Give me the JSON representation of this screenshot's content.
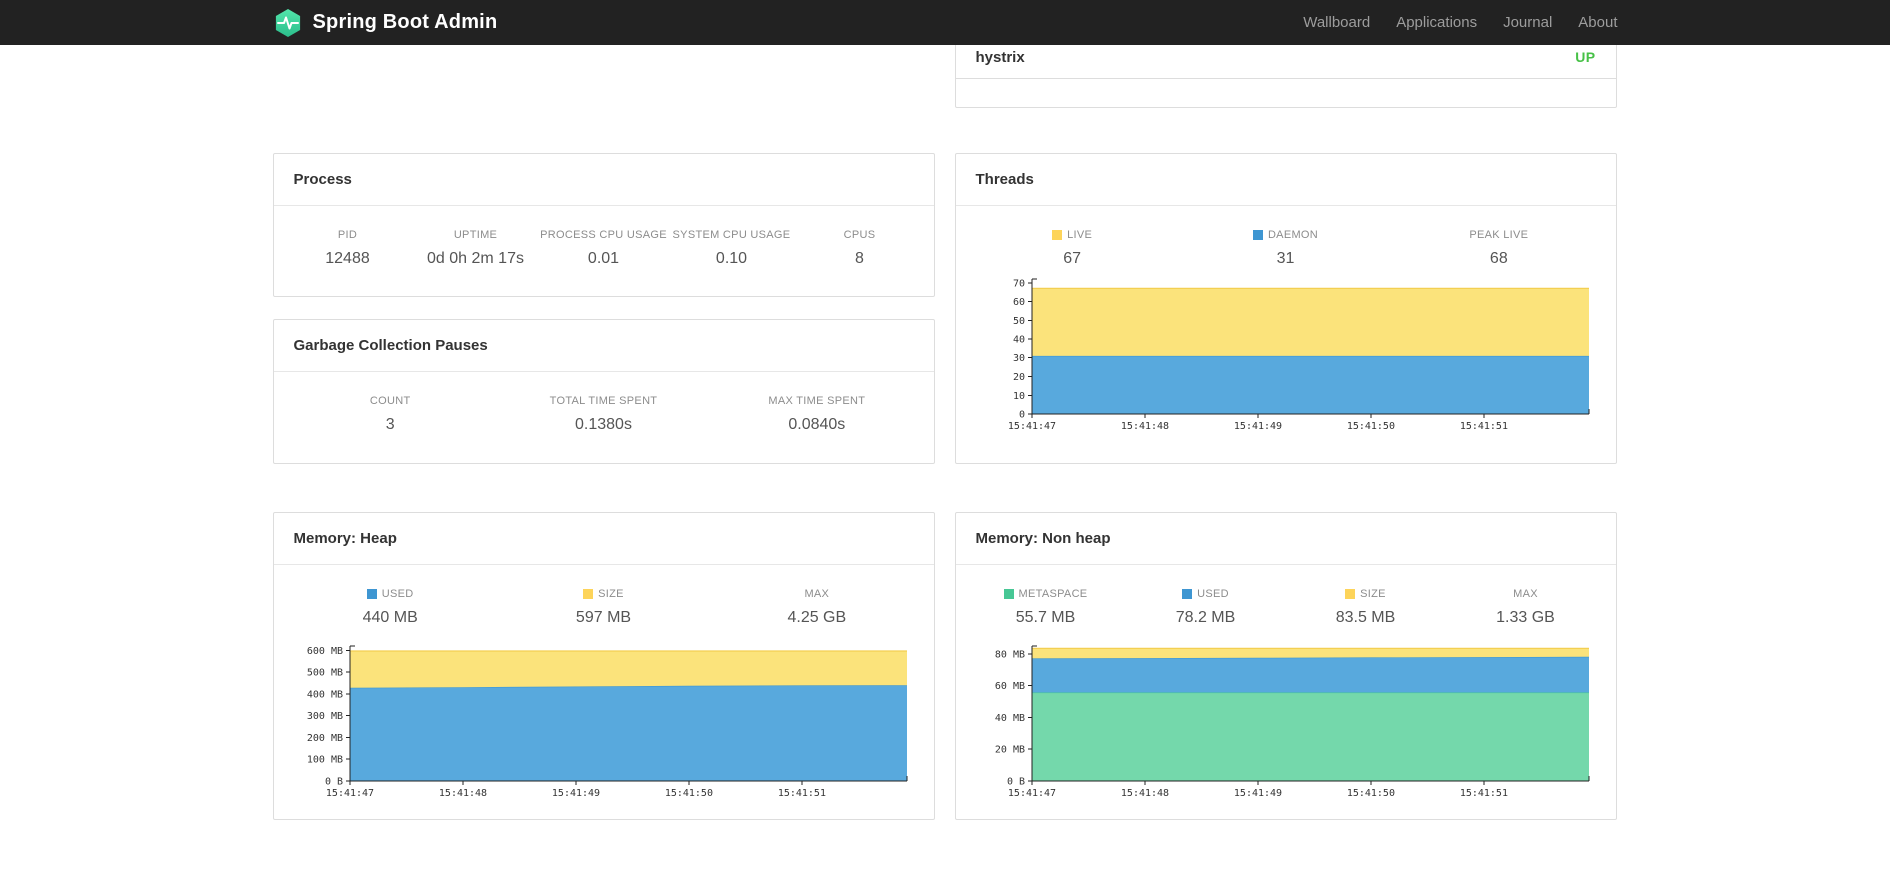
{
  "navbar": {
    "brand": "Spring Boot Admin",
    "links": [
      {
        "label": "Wallboard"
      },
      {
        "label": "Applications"
      },
      {
        "label": "Journal"
      },
      {
        "label": "About"
      }
    ]
  },
  "applications_panel": {
    "app_name": "hystrix",
    "app_status": "UP",
    "status_color": "#47c147"
  },
  "process_panel": {
    "title": "Process",
    "metrics": [
      {
        "label": "PID",
        "value": "12488"
      },
      {
        "label": "UPTIME",
        "value": "0d 0h 2m 17s"
      },
      {
        "label": "PROCESS CPU USAGE",
        "value": "0.01"
      },
      {
        "label": "SYSTEM CPU USAGE",
        "value": "0.10"
      },
      {
        "label": "CPUS",
        "value": "8"
      }
    ]
  },
  "gc_panel": {
    "title": "Garbage Collection Pauses",
    "metrics": [
      {
        "label": "COUNT",
        "value": "3"
      },
      {
        "label": "TOTAL TIME SPENT",
        "value": "0.1380s"
      },
      {
        "label": "MAX TIME SPENT",
        "value": "0.0840s"
      }
    ]
  },
  "threads_panel": {
    "title": "Threads",
    "legend": [
      {
        "label": "LIVE",
        "value": "67",
        "swatch": "#fdd45a"
      },
      {
        "label": "DAEMON",
        "value": "31",
        "swatch": "#3e96d2"
      },
      {
        "label": "PEAK LIVE",
        "value": "68",
        "swatch": ""
      }
    ]
  },
  "heap_panel": {
    "title": "Memory: Heap",
    "legend": [
      {
        "label": "USED",
        "value": "440 MB",
        "swatch": "#3e96d2"
      },
      {
        "label": "SIZE",
        "value": "597 MB",
        "swatch": "#fdd45a"
      },
      {
        "label": "MAX",
        "value": "4.25 GB",
        "swatch": ""
      }
    ]
  },
  "nonheap_panel": {
    "title": "Memory: Non heap",
    "legend": [
      {
        "label": "METASPACE",
        "value": "55.7 MB",
        "swatch": "#47c795"
      },
      {
        "label": "USED",
        "value": "78.2 MB",
        "swatch": "#3e96d2"
      },
      {
        "label": "SIZE",
        "value": "83.5 MB",
        "swatch": "#fdd45a"
      },
      {
        "label": "MAX",
        "value": "1.33 GB",
        "swatch": ""
      }
    ]
  },
  "colors": {
    "navbar_bg": "#222222",
    "brand_teal": "#3ccf9b",
    "status_up": "#47c147",
    "blue_fill": "#58a9dd",
    "blue_line": "#3e96d2",
    "yellow_fill": "#fbe37b",
    "yellow_line": "#f3cf52",
    "green_fill": "#74d8ab",
    "green_line": "#47c795"
  },
  "chart_data": [
    {
      "id": "threads",
      "type": "area",
      "stacked": true,
      "value_mode": "cumulative-stack-top",
      "x_ticks": [
        "15:41:47",
        "15:41:48",
        "15:41:49",
        "15:41:50",
        "15:41:51"
      ],
      "x": [
        0,
        1,
        2,
        3,
        4,
        4.93
      ],
      "ylim": [
        0,
        72
      ],
      "y_ticks": [
        {
          "v": 0,
          "label": "0"
        },
        {
          "v": 10,
          "label": "10"
        },
        {
          "v": 20,
          "label": "20"
        },
        {
          "v": 30,
          "label": "30"
        },
        {
          "v": 40,
          "label": "40"
        },
        {
          "v": 50,
          "label": "50"
        },
        {
          "v": 60,
          "label": "60"
        },
        {
          "v": 70,
          "label": "70"
        }
      ],
      "series": [
        {
          "name": "DAEMON",
          "fill": "#58a9dd",
          "line": "#3e96d2",
          "values": [
            31,
            31,
            31,
            31,
            31,
            31
          ]
        },
        {
          "name": "LIVE",
          "fill": "#fbe37b",
          "line": "#f3cf52",
          "values": [
            67,
            67,
            67,
            67,
            67,
            67
          ]
        }
      ]
    },
    {
      "id": "heap",
      "type": "area",
      "stacked": true,
      "value_mode": "cumulative-stack-top",
      "x_ticks": [
        "15:41:47",
        "15:41:48",
        "15:41:49",
        "15:41:50",
        "15:41:51"
      ],
      "x": [
        0,
        1,
        2,
        3,
        4,
        4.93
      ],
      "ylim": [
        0,
        620
      ],
      "y_ticks": [
        {
          "v": 0,
          "label": "0 B"
        },
        {
          "v": 100,
          "label": "100 MB"
        },
        {
          "v": 200,
          "label": "200 MB"
        },
        {
          "v": 300,
          "label": "300 MB"
        },
        {
          "v": 400,
          "label": "400 MB"
        },
        {
          "v": 500,
          "label": "500 MB"
        },
        {
          "v": 600,
          "label": "600 MB"
        }
      ],
      "series": [
        {
          "name": "USED",
          "fill": "#58a9dd",
          "line": "#3e96d2",
          "values": [
            428,
            431,
            434,
            437,
            439,
            440
          ]
        },
        {
          "name": "SIZE",
          "fill": "#fbe37b",
          "line": "#f3cf52",
          "values": [
            597,
            597,
            597,
            597,
            597,
            597
          ]
        }
      ]
    },
    {
      "id": "nonheap",
      "type": "area",
      "stacked": true,
      "value_mode": "cumulative-stack-top",
      "x_ticks": [
        "15:41:47",
        "15:41:48",
        "15:41:49",
        "15:41:50",
        "15:41:51"
      ],
      "x": [
        0,
        1,
        2,
        3,
        4,
        4.93
      ],
      "ylim": [
        0,
        85
      ],
      "y_ticks": [
        {
          "v": 0,
          "label": "0 B"
        },
        {
          "v": 20,
          "label": "20 MB"
        },
        {
          "v": 40,
          "label": "40 MB"
        },
        {
          "v": 60,
          "label": "60 MB"
        },
        {
          "v": 80,
          "label": "80 MB"
        }
      ],
      "series": [
        {
          "name": "METASPACE",
          "fill": "#74d8ab",
          "line": "#47c795",
          "values": [
            55.7,
            55.7,
            55.7,
            55.7,
            55.7,
            55.7
          ]
        },
        {
          "name": "USED",
          "fill": "#58a9dd",
          "line": "#3e96d2",
          "values": [
            77.2,
            77.4,
            77.6,
            77.8,
            78.0,
            78.2
          ]
        },
        {
          "name": "SIZE",
          "fill": "#fbe37b",
          "line": "#f3cf52",
          "values": [
            83.5,
            83.5,
            83.5,
            83.5,
            83.5,
            83.5
          ]
        }
      ]
    }
  ]
}
